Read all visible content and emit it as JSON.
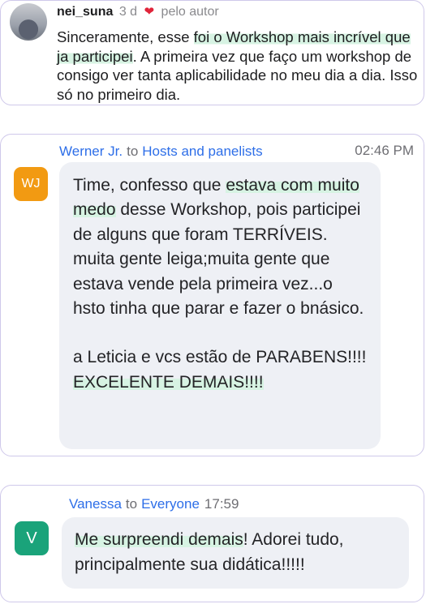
{
  "comment": {
    "username": "nei_suna",
    "time_ago": "3 d",
    "liked_by": "pelo autor",
    "text_before": "Sinceramente, esse ",
    "text_highlight": "foi o Workshop mais incrível que ja participei",
    "text_after": ". A primeira vez que faço um workshop de consigo ver tanta aplicabilidade no meu dia a dia. Isso só no primeiro dia."
  },
  "chat_messages": [
    {
      "sender": "Werner Jr.",
      "to_word": "to",
      "recipient": "Hosts and panelists",
      "time": "02:46 PM",
      "initials": "WJ",
      "avatar_color": "#f29a12",
      "text_before": "Time, confesso que ",
      "text_highlight": "estava com muito medo",
      "text_after": " desse Workshop, pois participei de alguns que foram TERRÍVEIS. muita gente leiga;muita gente que estava vende pela primeira vez...o hsto tinha que parar e fazer o bnásico.",
      "text_para2": "a Leticia e vcs estão de PARABENS!!!!",
      "text_para3": "EXCELENTE DEMAIS!!!!"
    },
    {
      "sender": "Vanessa",
      "to_word": "to",
      "recipient": "Everyone",
      "time": "17:59",
      "initials": "V",
      "avatar_color": "#1aa37a",
      "text_highlight": "Me surpreendi demais",
      "text_after": "! Adorei tudo, principalmente sua didática!!!!!"
    }
  ]
}
